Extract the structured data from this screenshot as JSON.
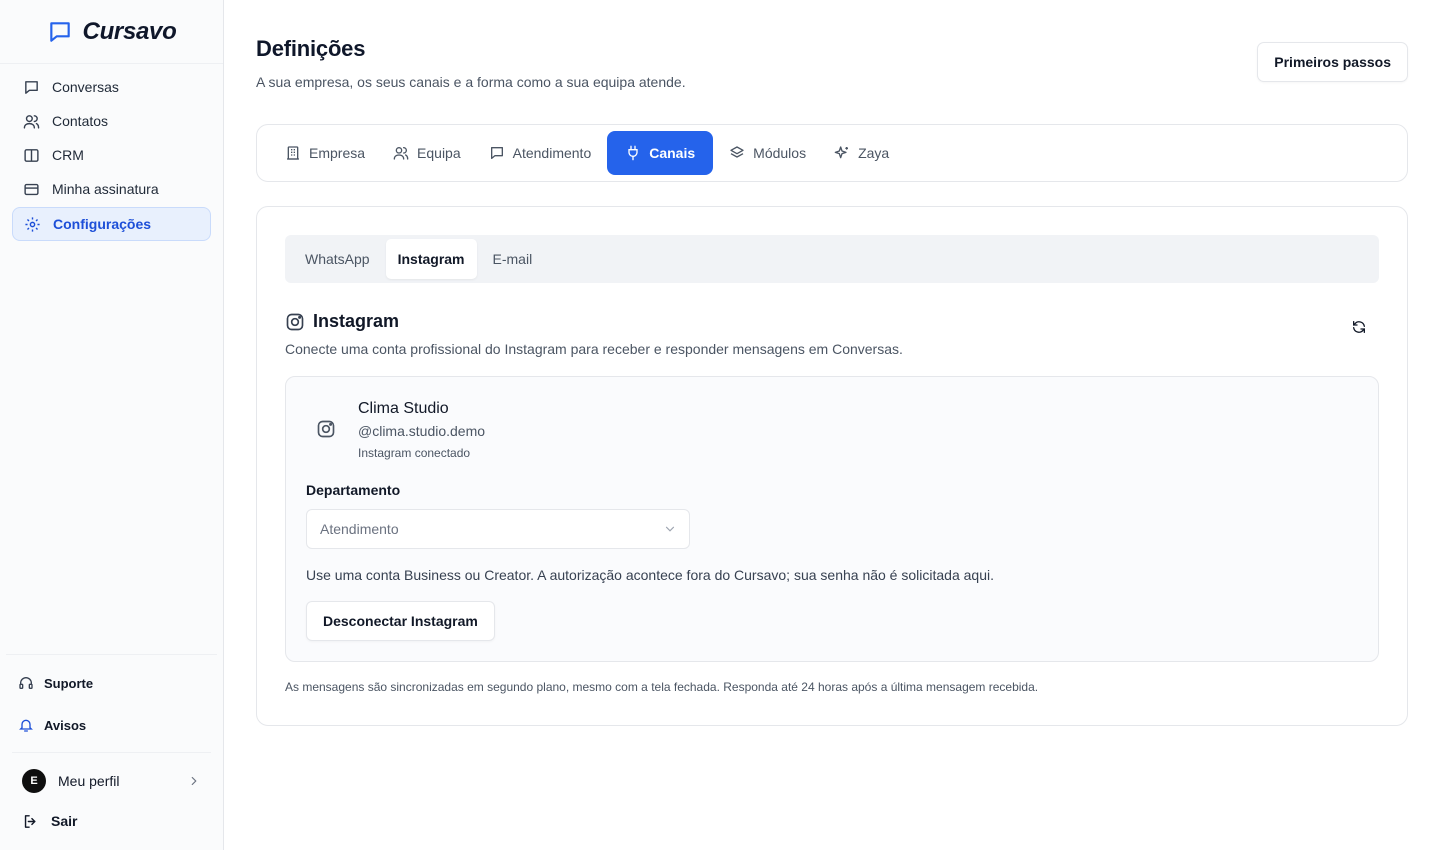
{
  "app": {
    "name": "Cursavo"
  },
  "sidebar": {
    "items": [
      {
        "label": "Conversas",
        "icon": "chat-icon"
      },
      {
        "label": "Contatos",
        "icon": "users-icon"
      },
      {
        "label": "CRM",
        "icon": "columns-icon"
      },
      {
        "label": "Minha assinatura",
        "icon": "credit-card-icon"
      },
      {
        "label": "Configurações",
        "icon": "gear-icon",
        "active": true
      }
    ],
    "support_label": "Suporte",
    "notices_label": "Avisos",
    "profile": {
      "initial": "E",
      "label": "Meu perfil"
    },
    "logout_label": "Sair"
  },
  "header": {
    "title": "Definições",
    "subtitle": "A sua empresa, os seus canais e a forma como a sua equipa atende.",
    "action_label": "Primeiros passos"
  },
  "tabs": [
    {
      "label": "Empresa",
      "icon": "building-icon"
    },
    {
      "label": "Equipa",
      "icon": "users-icon"
    },
    {
      "label": "Atendimento",
      "icon": "chat-icon"
    },
    {
      "label": "Canais",
      "icon": "plug-icon",
      "active": true
    },
    {
      "label": "Módulos",
      "icon": "layers-icon"
    },
    {
      "label": "Zaya",
      "icon": "sparkles-icon"
    }
  ],
  "channel_tabs": [
    {
      "label": "WhatsApp"
    },
    {
      "label": "Instagram",
      "active": true
    },
    {
      "label": "E-mail"
    }
  ],
  "section": {
    "title": "Instagram",
    "description": "Conecte uma conta profissional do Instagram para receber e responder mensagens em Conversas."
  },
  "account": {
    "name": "Clima Studio",
    "handle": "@clima.studio.demo",
    "status": "Instagram conectado",
    "department_label": "Departamento",
    "department_value": "Atendimento",
    "help": "Use uma conta Business ou Creator. A autorização acontece fora do Cursavo; sua senha não é solicitada aqui.",
    "disconnect_label": "Desconectar Instagram"
  },
  "footnote": "As mensagens são sincronizadas em segundo plano, mesmo com a tela fechada. Responda até 24 horas após a última mensagem recebida.",
  "colors": {
    "accent": "#2563eb",
    "accent_soft": "#e8f0fd"
  }
}
